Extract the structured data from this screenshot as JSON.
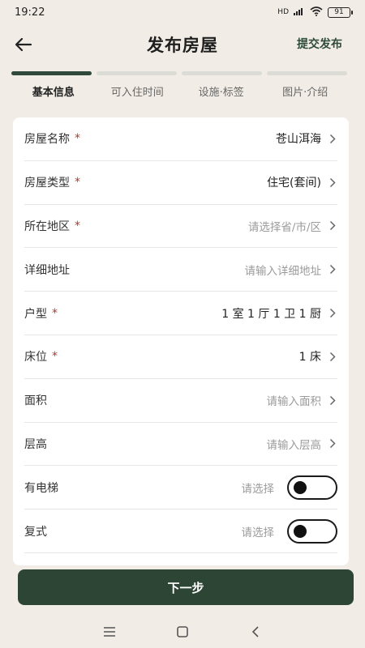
{
  "status_bar": {
    "time": "19:22",
    "network": "HD",
    "battery": "91"
  },
  "header": {
    "title": "发布房屋",
    "submit_label": "提交发布"
  },
  "steps": [
    {
      "label": "基本信息",
      "active": true
    },
    {
      "label": "可入住时间",
      "active": false
    },
    {
      "label": "设施·标签",
      "active": false
    },
    {
      "label": "图片·介绍",
      "active": false
    }
  ],
  "form": {
    "house_name": {
      "label": "房屋名称",
      "required": "*",
      "value": "苍山洱海"
    },
    "house_type": {
      "label": "房屋类型",
      "required": "*",
      "value": "住宅(套间)"
    },
    "region": {
      "label": "所在地区",
      "required": "*",
      "placeholder": "请选择省/市/区"
    },
    "address": {
      "label": "详细地址",
      "placeholder": "请输入详细地址"
    },
    "layout": {
      "label": "户型",
      "required": "*",
      "value": "1 室 1 厅 1 卫 1 厨"
    },
    "beds": {
      "label": "床位",
      "required": "*",
      "value": "1 床"
    },
    "area": {
      "label": "面积",
      "placeholder": "请输入面积"
    },
    "floor_height": {
      "label": "层高",
      "placeholder": "请输入层高"
    },
    "elevator": {
      "label": "有电梯",
      "placeholder": "请选择"
    },
    "duplex": {
      "label": "复式",
      "placeholder": "请选择"
    }
  },
  "next_button": "下一步",
  "colors": {
    "accent": "#2d4535",
    "required": "#b03a2e",
    "background": "#f1ede6"
  },
  "icons": [
    "back-arrow-icon",
    "chevron-right-icon",
    "menu-icon",
    "home-square-icon",
    "back-nav-icon",
    "wifi-icon",
    "signal-icon",
    "battery-icon"
  ]
}
